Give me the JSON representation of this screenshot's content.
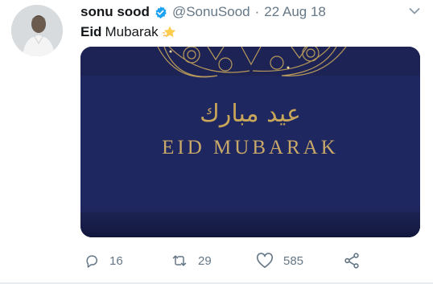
{
  "tweet": {
    "author_name": "sonu sood",
    "handle": "@SonuSood",
    "separator": "·",
    "date": "22 Aug 18",
    "text_bold": "Eid",
    "text_rest": "Mubarak",
    "text_emoji": "star-emoji"
  },
  "media": {
    "arabic_text": "عيد مبارك",
    "latin_text": "EID MUBARAK"
  },
  "actions": {
    "replies": "16",
    "retweets": "29",
    "likes": "585"
  },
  "colors": {
    "verified": "#1da1f2",
    "muted": "#657786",
    "media_bg": "#1c2352",
    "gold": "#c9a968"
  }
}
